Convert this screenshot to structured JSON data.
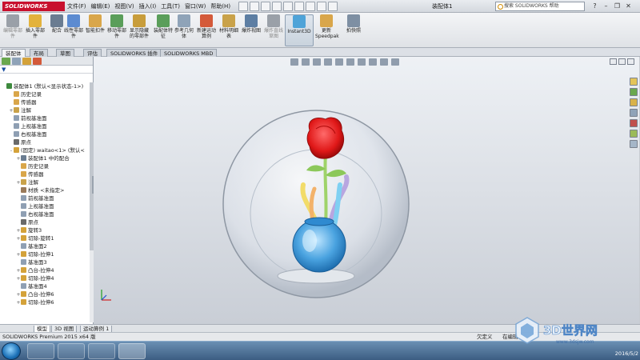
{
  "app": {
    "logo_text": "SOLIDWORKS",
    "document_title": "装配体1",
    "search_placeholder": "搜索 SOLIDWORKS 帮助"
  },
  "menu": [
    "文件(F)",
    "编辑(E)",
    "视图(V)",
    "插入(I)",
    "工具(T)",
    "窗口(W)",
    "帮助(H)"
  ],
  "ribbon": [
    {
      "label": "编辑零部件",
      "color": "#9aa0a8",
      "dim": true
    },
    {
      "label": "插入零部件",
      "color": "#e3b23c",
      "dim": false
    },
    {
      "label": "配合",
      "color": "#6a7c91",
      "dim": false
    },
    {
      "label": "线性零部件",
      "color": "#5c8bd1",
      "dim": false
    },
    {
      "label": "智能扣件",
      "color": "#d9a64a",
      "dim": false
    },
    {
      "label": "移动零部件",
      "color": "#5a9e5a",
      "dim": false
    },
    {
      "label": "显示隐藏的零部件",
      "color": "#c89d3b",
      "dim": false
    },
    {
      "label": "装配体特征",
      "color": "#5a9e5a",
      "dim": false
    },
    {
      "label": "参考几何体",
      "color": "#8fa3b8",
      "dim": false
    },
    {
      "label": "新建运动算例",
      "color": "#d45a3a",
      "dim": false
    },
    {
      "label": "材料明细表",
      "color": "#c9a24a",
      "dim": false
    },
    {
      "label": "爆炸视图",
      "color": "#5d7ea3",
      "dim": false
    },
    {
      "label": "爆炸直线草图",
      "color": "#9aa0a8",
      "dim": true
    },
    {
      "label": "Instant3D",
      "color": "#4ea3d8",
      "dim": false,
      "active": true
    },
    {
      "label": "更新Speedpak",
      "color": "#d9a64a",
      "dim": false
    },
    {
      "label": "拍快照",
      "color": "#7e8fa3",
      "dim": false
    }
  ],
  "command_tabs": [
    "装配体",
    "布局",
    "草图",
    "评估",
    "SOLIDWORKS 插件",
    "SOLIDWORKS MBD"
  ],
  "tree": [
    {
      "level": 0,
      "exp": "",
      "label": "装配体1 (默认<显示状态-1>)",
      "color": "#3e8a3e"
    },
    {
      "level": 1,
      "exp": "",
      "label": "历史记录",
      "color": "#d9a64a"
    },
    {
      "level": 1,
      "exp": "",
      "label": "传感器",
      "color": "#d9a64a"
    },
    {
      "level": 1,
      "exp": "+",
      "label": "注解",
      "color": "#c9a24a"
    },
    {
      "level": 1,
      "exp": "",
      "label": "前视基准面",
      "color": "#8f9fb3"
    },
    {
      "level": 1,
      "exp": "",
      "label": "上视基准面",
      "color": "#8f9fb3"
    },
    {
      "level": 1,
      "exp": "",
      "label": "右视基准面",
      "color": "#8f9fb3"
    },
    {
      "level": 1,
      "exp": "",
      "label": "原点",
      "color": "#6a6a6a"
    },
    {
      "level": 1,
      "exp": "-",
      "label": "(固定) waitao<1> (默认<",
      "color": "#d4a23a"
    },
    {
      "level": 2,
      "exp": "+",
      "label": "装配体1 中的配合",
      "color": "#6a7c91"
    },
    {
      "level": 2,
      "exp": "",
      "label": "历史记录",
      "color": "#d9a64a"
    },
    {
      "level": 2,
      "exp": "",
      "label": "传感器",
      "color": "#d9a64a"
    },
    {
      "level": 2,
      "exp": "+",
      "label": "注解",
      "color": "#c9a24a"
    },
    {
      "level": 2,
      "exp": "",
      "label": "材质 <未指定>",
      "color": "#9a7a5a"
    },
    {
      "level": 2,
      "exp": "",
      "label": "前视基准面",
      "color": "#8f9fb3"
    },
    {
      "level": 2,
      "exp": "",
      "label": "上视基准面",
      "color": "#8f9fb3"
    },
    {
      "level": 2,
      "exp": "",
      "label": "右视基准面",
      "color": "#8f9fb3"
    },
    {
      "level": 2,
      "exp": "",
      "label": "原点",
      "color": "#6a6a6a"
    },
    {
      "level": 2,
      "exp": "+",
      "label": "旋转3",
      "color": "#d4a23a"
    },
    {
      "level": 2,
      "exp": "+",
      "label": "切除-旋转1",
      "color": "#d4a23a"
    },
    {
      "level": 2,
      "exp": "",
      "label": "基准面2",
      "color": "#8f9fb3"
    },
    {
      "level": 2,
      "exp": "+",
      "label": "切除-拉伸1",
      "color": "#d4a23a"
    },
    {
      "level": 2,
      "exp": "",
      "label": "基准面3",
      "color": "#8f9fb3"
    },
    {
      "level": 2,
      "exp": "+",
      "label": "凸台-拉伸4",
      "color": "#d4a23a"
    },
    {
      "level": 2,
      "exp": "+",
      "label": "切除-拉伸4",
      "color": "#d4a23a"
    },
    {
      "level": 2,
      "exp": "",
      "label": "基准面4",
      "color": "#8f9fb3"
    },
    {
      "level": 2,
      "exp": "+",
      "label": "凸台-拉伸6",
      "color": "#d4a23a"
    },
    {
      "level": 2,
      "exp": "+",
      "label": "切除-拉伸6",
      "color": "#d4a23a"
    }
  ],
  "bottom_tabs": [
    "模型",
    "3D 视图",
    "运动算例 1"
  ],
  "status": {
    "product": "SOLIDWORKS Premium 2015 x64 版",
    "state": "欠定义",
    "editing": "在编辑"
  },
  "tray": {
    "date": "2016/5/2"
  },
  "watermark": {
    "text": "3D世界网",
    "url": "www.3dsjw.com"
  }
}
